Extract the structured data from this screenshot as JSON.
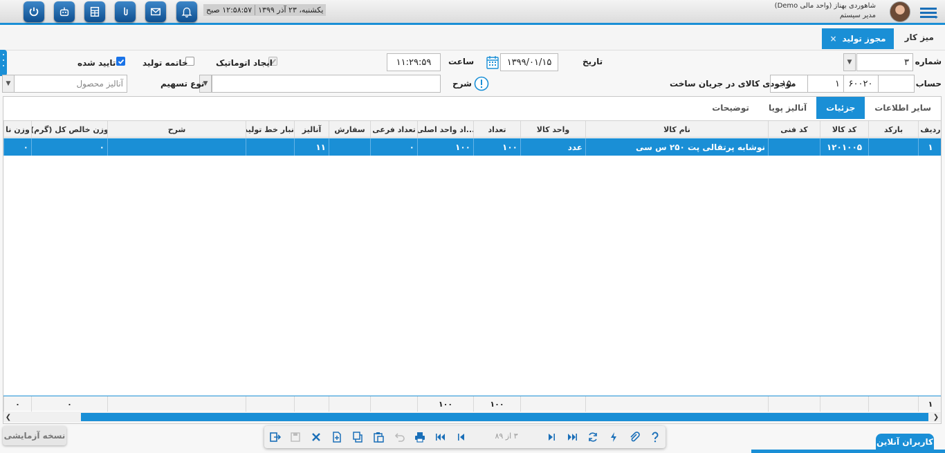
{
  "header": {
    "date_text": "یکشنبه، ۲۳ آذر ۱۳۹۹",
    "time_text": "۱۲:۵۸:۵۷ صبح",
    "user_name": "شاهوردی بهناز (واحد مالی Demo)",
    "user_role": "مدیر سیستم",
    "toolbar_icons": [
      "power-icon",
      "robot-icon",
      "calculator-icon",
      "pin-icon",
      "mail-icon",
      "bell-icon"
    ]
  },
  "tabs": {
    "home": "میز کار",
    "active": "مجوز تولید",
    "close": "×"
  },
  "form": {
    "number_label": "شماره",
    "number_value": "۳",
    "date_label": "تاریخ",
    "date_value": "۱۳۹۹/۰۱/۱۵",
    "time_label": "ساعت",
    "time_value": "۱۱:۲۹:۵۹",
    "auto_create_label": "ایجاد اتوماتیک",
    "end_production_label": "خاتمه تولید",
    "approved_label": "تایید شده",
    "account_label": "حساب",
    "account_code": "۶۰۰۲۰",
    "account_sub": "۱",
    "account_detail": "۱۵۰",
    "account_name": "موجودی کالای در جریان ساخت",
    "desc_label": "شرح",
    "share_type_label": "نوع تسهیم",
    "product_analysis_placeholder": "آنالیز محصول"
  },
  "grid": {
    "subtabs": [
      "سایر اطلاعات",
      "جزئیات",
      "آنالیز پویا",
      "توضیحات"
    ],
    "active_subtab": "جزئیات",
    "columns": [
      "ردیف",
      "بارکد",
      "کد کالا",
      "کد فنی",
      "نام کالا",
      "واحد کالا",
      "تعداد",
      "...اد واحد اصلی",
      "تعداد فرعی",
      "سفارش",
      "آنالیز",
      "انبار خط تولید",
      "شرح",
      "وزن خالص کل (گرم)",
      "وزن نا"
    ],
    "rows": [
      [
        "۱",
        "",
        "۱۲۰۱۰۰۵",
        "",
        "نوشابه پرتقالی پت ۲۵۰ س سی",
        "عدد",
        "۱۰۰",
        "۱۰۰",
        "۰",
        "",
        "۱۱",
        "",
        "",
        "۰",
        "۰"
      ]
    ],
    "footer": [
      "۱",
      "",
      "",
      "",
      "",
      "",
      "۱۰۰",
      "۱۰۰",
      "",
      "",
      "",
      "",
      "",
      "۰",
      "۰"
    ]
  },
  "bottom": {
    "test_version": "نسخه آزمایشی",
    "pager": "۳ از ۸۹",
    "online_users": "کاربران آنلاین"
  },
  "colors": {
    "accent": "#1a8fd6",
    "button_dark": "#0f4f8f"
  }
}
